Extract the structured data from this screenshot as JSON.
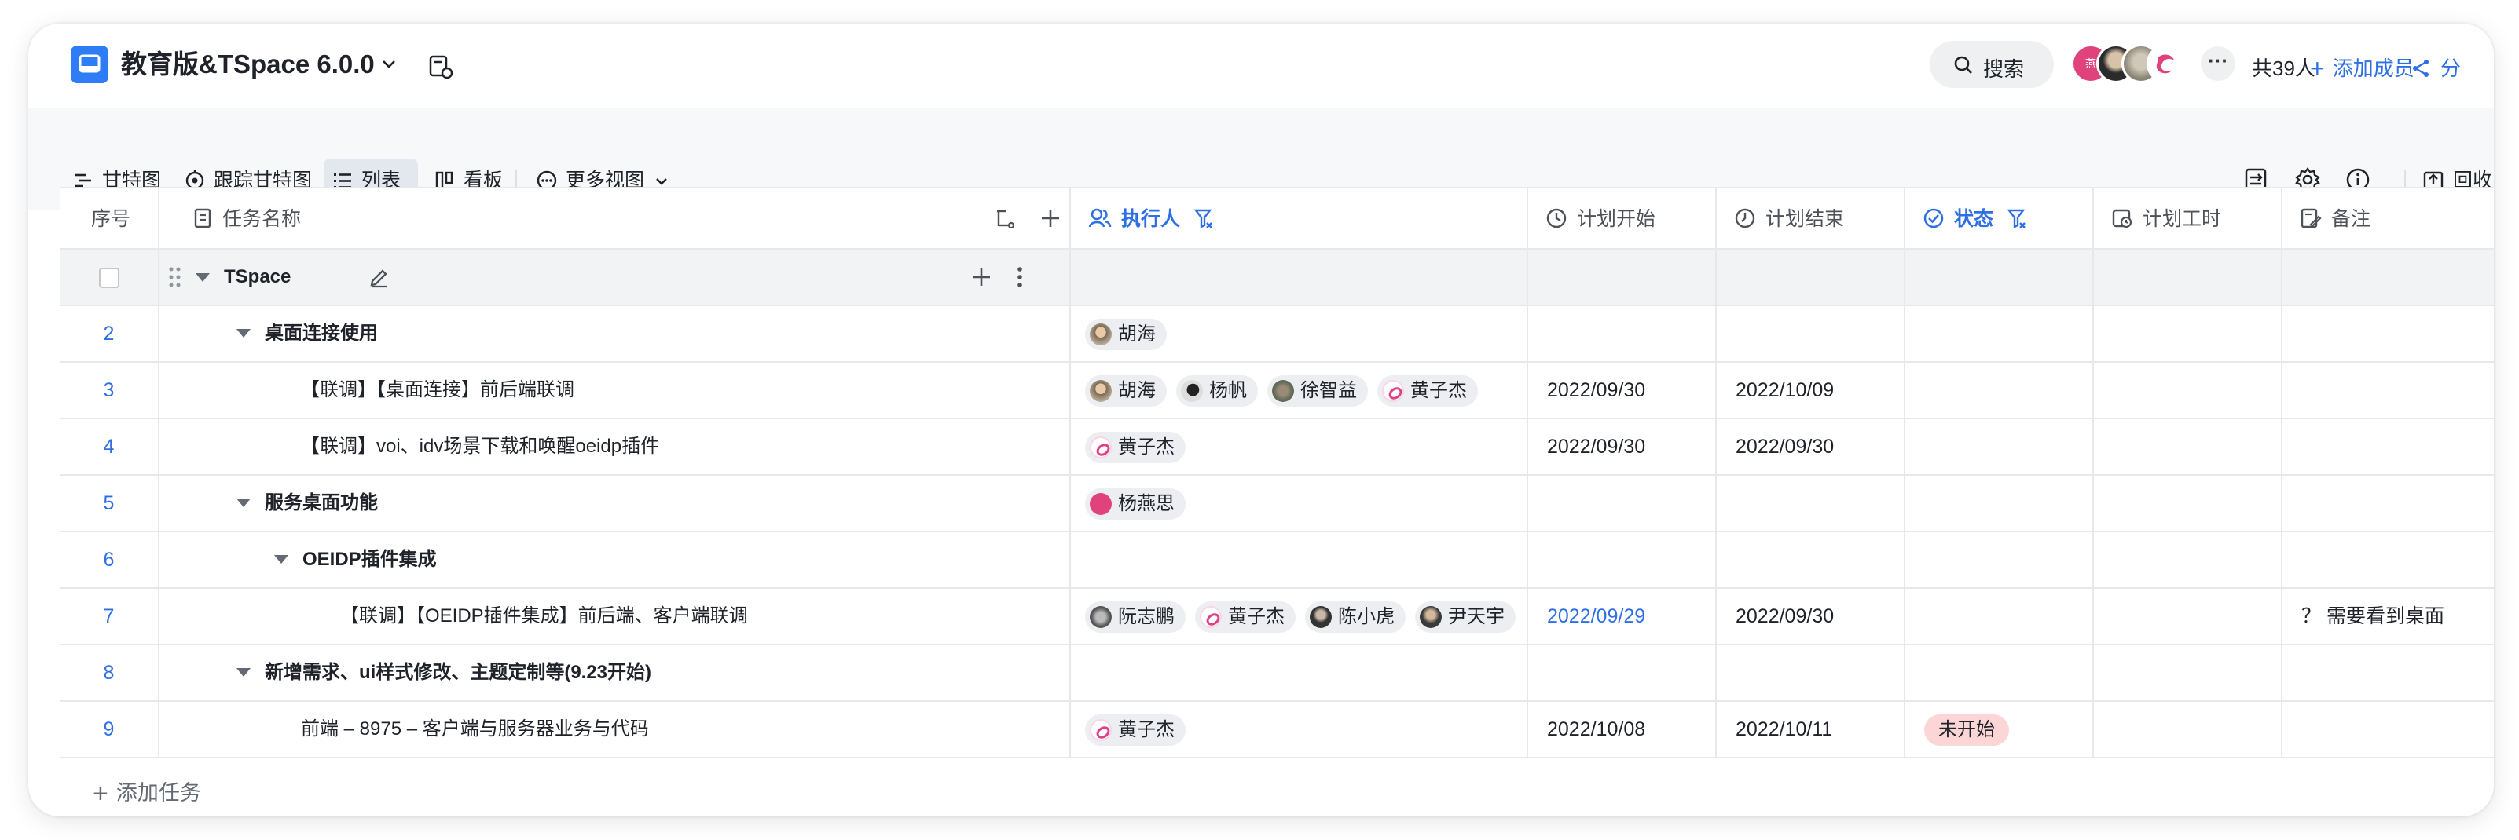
{
  "header": {
    "title": "教育版&TSpace 6.0.0",
    "search_label": "搜索",
    "member_count": "共39人",
    "add_member": "添加成员",
    "share": "分",
    "avatar_first_text": "燕"
  },
  "toolbar": {
    "views": [
      {
        "label": "甘特图",
        "icon": "gantt-icon"
      },
      {
        "label": "跟踪甘特图",
        "icon": "track-gantt-icon"
      },
      {
        "label": "列表",
        "icon": "list-icon",
        "active": true
      },
      {
        "label": "看板",
        "icon": "kanban-icon"
      },
      {
        "label": "更多视图",
        "icon": "more-views-icon"
      }
    ],
    "recycle": "回收"
  },
  "columns": {
    "no": "序号",
    "name": "任务名称",
    "assignee": "执行人",
    "start": "计划开始",
    "end": "计划结束",
    "status": "状态",
    "hours": "计划工时",
    "notes": "备注"
  },
  "group": {
    "name": "TSpace"
  },
  "rows": [
    {
      "no": "2",
      "name": "桌面连接使用",
      "assignees": [
        "胡海"
      ],
      "start": "",
      "end": "",
      "status": "",
      "notes": ""
    },
    {
      "no": "3",
      "name": "【联调】【桌面连接】前后端联调",
      "assignees": [
        "胡海",
        "杨帆",
        "徐智益",
        "黄子杰"
      ],
      "start": "2022/09/30",
      "end": "2022/10/09",
      "status": "",
      "notes": ""
    },
    {
      "no": "4",
      "name": "【联调】voi、idv场景下载和唤醒oeidp插件",
      "assignees": [
        "黄子杰"
      ],
      "start": "2022/09/30",
      "end": "2022/09/30",
      "status": "",
      "notes": ""
    },
    {
      "no": "5",
      "name": "服务桌面功能",
      "assignees": [
        "杨燕思"
      ],
      "start": "",
      "end": "",
      "status": "",
      "notes": ""
    },
    {
      "no": "6",
      "name": "OEIDP插件集成",
      "assignees": [],
      "start": "",
      "end": "",
      "status": "",
      "notes": ""
    },
    {
      "no": "7",
      "name": "【联调】【OEIDP插件集成】前后端、客户端联调",
      "assignees": [
        "阮志鹏",
        "黄子杰",
        "陈小虎",
        "尹天宇"
      ],
      "start": "2022/09/29",
      "end": "2022/09/30",
      "status": "",
      "notes": "？ 需要看到桌面"
    },
    {
      "no": "8",
      "name": "新增需求、ui样式修改、主题定制等(9.23开始)",
      "assignees": [],
      "start": "",
      "end": "",
      "status": "",
      "notes": ""
    },
    {
      "no": "9",
      "name": "前端 – 8975 – 客户端与服务器业务与代码",
      "assignees": [
        "黄子杰"
      ],
      "start": "2022/10/08",
      "end": "2022/10/11",
      "status": "未开始",
      "notes": ""
    }
  ],
  "add_task": "添加任务",
  "colors": {
    "accent": "#2f6fe4",
    "app_icon": "#2f7df6",
    "status_not_started": "#fcd6d6"
  }
}
